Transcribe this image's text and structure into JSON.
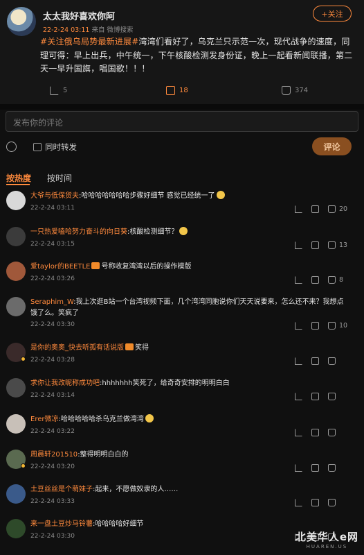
{
  "post": {
    "author": "太太我好喜欢你阿",
    "date": "22-2-24 03:11",
    "source": "来自 微博搜索",
    "follow_label": "+关注",
    "tag": "#关注俄乌局势最新进展#",
    "body": "湾湾们看好了，乌克兰只示范一次，现代战争的速度，同理可得：早上出兵，中午统一，下午核酸检测发身份证，晚上一起看新闻联播，第二天一早升国旗，唱国歌！！！",
    "share_count": "5",
    "comment_count": "18",
    "like_count": "374"
  },
  "compose": {
    "placeholder": "发布你的评论",
    "repost_label": "同时转发",
    "submit_label": "评论"
  },
  "sort_tabs": {
    "hot": "按热度",
    "time": "按时间"
  },
  "comments": [
    {
      "user": "大爷与低保货夫",
      "text": ":哈哈哈哈哈哈哈步骤好细节 感觉已经统一了",
      "time": "22-2-24 03:11",
      "likes": "20",
      "emoji": true
    },
    {
      "user": "一只热爱嗑哈努力奋斗的向日葵",
      "text": ":核酸检测细节？",
      "time": "22-2-24 03:15",
      "likes": "13",
      "emoji": true
    },
    {
      "user": "爱taylor的BEETLE",
      "text": "号称收复湾湾以后的操作模版",
      "time": "22-2-24 03:26",
      "likes": "8",
      "crown": true
    },
    {
      "user": "Seraphim_W",
      "text": ":我上次逛B站一个台湾视频下面，几个湾湾同胞说你们天天说要来，怎么还不来？我想点饿了么。笑疯了",
      "time": "22-2-24 03:30",
      "likes": "10"
    },
    {
      "user": "是你的奥奥_快去听孤有话说版",
      "text": "笑得",
      "time": "22-2-24 03:28",
      "likes": "",
      "crown": true,
      "vdot": true
    },
    {
      "user": "求你让我改昵称成功吧",
      "text": ":hhhhhhh笑死了，给奇奇安排的明明白白",
      "time": "22-2-24 03:14",
      "likes": ""
    },
    {
      "user": "Erer微凉",
      "text": ":哈哈哈哈哈杀乌克兰做湾湾",
      "time": "22-2-24 03:22",
      "likes": "",
      "emoji": true
    },
    {
      "user": "周晨轩201510",
      "text": ":整得明明白白的",
      "time": "22-2-24 03:20",
      "likes": "",
      "vdot": true
    },
    {
      "user": "土豆丝丝是个萌妹子",
      "text": ":起来，不愿做奴隶的人……",
      "time": "22-2-24 03:33",
      "likes": ""
    },
    {
      "user": "来一盘土豆炒马铃薯",
      "text": ":哈哈哈哈好细节",
      "time": "22-2-24 03:30",
      "likes": ""
    }
  ],
  "watermark": {
    "title": "北美华人e网",
    "subtitle": "HUAREN.US"
  }
}
